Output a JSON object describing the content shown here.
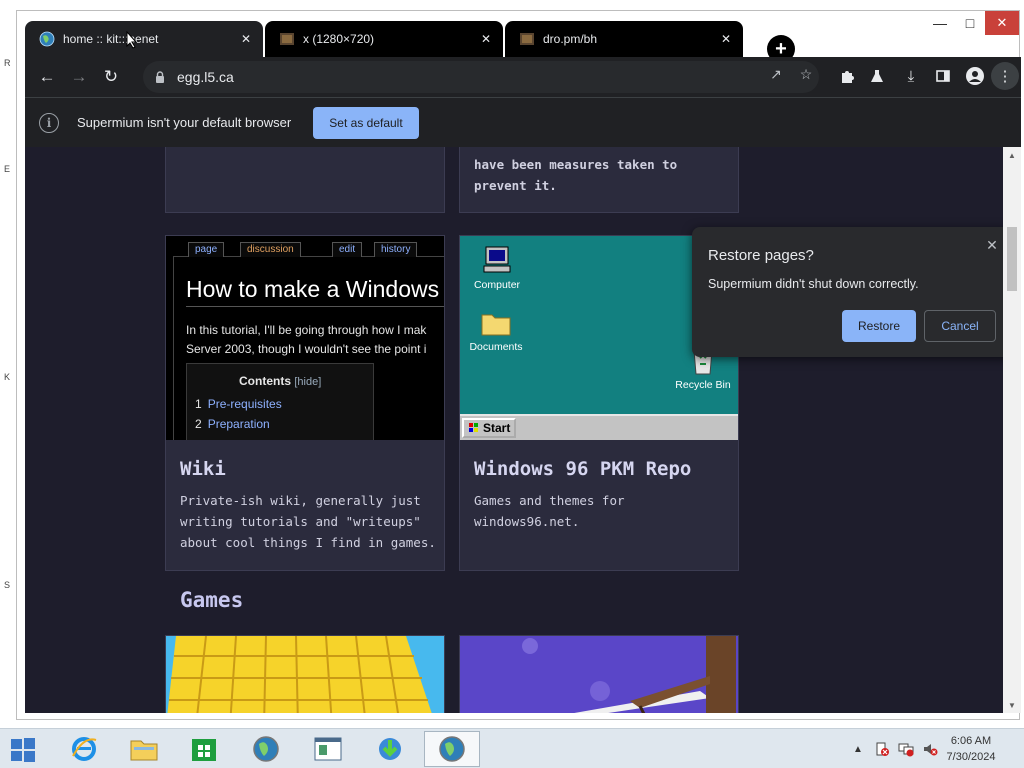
{
  "browser": {
    "tabs": [
      {
        "title": "home :: kit:::nenet",
        "active": true
      },
      {
        "title": "x (1280×720)",
        "active": false
      },
      {
        "title": "dro.pm/bh",
        "active": false
      }
    ],
    "new_tab_label": "+",
    "url": "egg.l5.ca",
    "infobar": {
      "message": "Supermium isn't your default browser",
      "button": "Set as default"
    },
    "restore_bubble": {
      "title": "Restore pages?",
      "body": "Supermium didn't shut down correctly.",
      "restore_button": "Restore",
      "cancel_button": "Cancel"
    }
  },
  "page": {
    "top_card_right_text": [
      "have been measures taken to",
      "prevent it."
    ],
    "wiki_card": {
      "title": "Wiki",
      "description": "Private-ish wiki, generally just\nwriting tutorials and \"writeups\"\nabout cool things I find in games.",
      "preview": {
        "tabs": [
          "page",
          "discussion",
          "edit",
          "history"
        ],
        "heading": "How to make a Windows",
        "body_lines": [
          "In this tutorial, I'll be going through how I mak",
          "Server 2003, though I wouldn't see the point i"
        ],
        "toc_title": "Contents",
        "toc_hide": "[hide]",
        "toc_items": [
          {
            "num": "1",
            "label": "Pre-requisites"
          },
          {
            "num": "2",
            "label": "Preparation"
          }
        ]
      }
    },
    "w96_card": {
      "title": "Windows 96 PKM Repo",
      "description": "Games and themes for\nwindows96.net.",
      "preview": {
        "icons": [
          "Computer",
          "Documents",
          "Recycle Bin"
        ],
        "start_label": "Start"
      }
    },
    "games_heading": "Games"
  },
  "taskbar": {
    "time": "6:06 AM",
    "date": "7/30/2024"
  },
  "colors": {
    "page_bg": "#1e1d2c",
    "card_bg": "#2b2b3d",
    "accent_button": "#8ab4f8",
    "chrome_dark": "#202124"
  }
}
